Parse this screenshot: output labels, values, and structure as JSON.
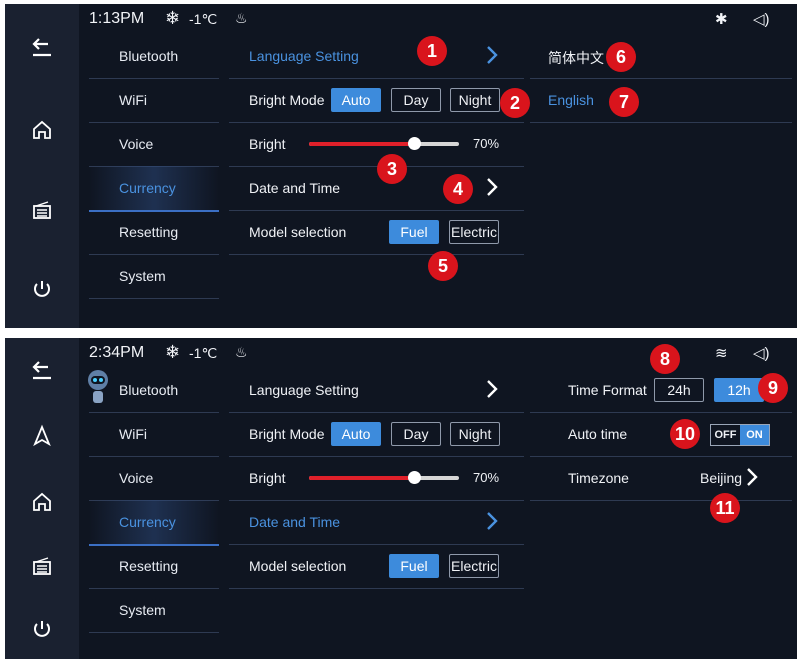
{
  "colors": {
    "accent": "#3d8bdc",
    "badge": "#d9141c",
    "slider_fill": "#e0202a",
    "background": "#0f1521"
  },
  "screen1": {
    "status": {
      "time": "1:13PM",
      "snow_icon": "❄",
      "temp": "-1℃",
      "fan_icon": "♨",
      "bluetooth_icon": "✱",
      "volume_icon": "◁)"
    },
    "menu": [
      "Bluetooth",
      "WiFi",
      "Voice",
      "Currency",
      "Resetting",
      "System"
    ],
    "active_menu": "Currency",
    "rows": {
      "language": "Language Setting",
      "bright_mode": "Bright Mode",
      "modes": [
        "Auto",
        "Day",
        "Night"
      ],
      "bright": "Bright",
      "bright_value": "70%",
      "bright_level": 0.7,
      "date_time": "Date and Time",
      "model": "Model selection",
      "models": [
        "Fuel",
        "Electric"
      ]
    },
    "languages": [
      "简体中文",
      "English"
    ],
    "badges": [
      "1",
      "2",
      "3",
      "4",
      "5",
      "6",
      "7"
    ]
  },
  "screen2": {
    "status": {
      "time": "2:34PM",
      "snow_icon": "❄",
      "temp": "-1℃",
      "fan_icon": "♨",
      "wifi_icon": "≋",
      "volume_icon": "◁)"
    },
    "menu": [
      "Bluetooth",
      "WiFi",
      "Voice",
      "Currency",
      "Resetting",
      "System"
    ],
    "active_menu": "Currency",
    "rows": {
      "language": "Language Setting",
      "bright_mode": "Bright Mode",
      "modes": [
        "Auto",
        "Day",
        "Night"
      ],
      "bright": "Bright",
      "bright_value": "70%",
      "bright_level": 0.7,
      "date_time": "Date and Time",
      "model": "Model selection",
      "models": [
        "Fuel",
        "Electric"
      ]
    },
    "time_format_label": "Time Format",
    "time_formats": [
      "24h",
      "12h"
    ],
    "auto_time_label": "Auto time",
    "toggle": {
      "off": "OFF",
      "on": "ON"
    },
    "timezone_label": "Timezone",
    "timezone_value": "Beijing",
    "badges": [
      "8",
      "9",
      "10",
      "11"
    ]
  }
}
